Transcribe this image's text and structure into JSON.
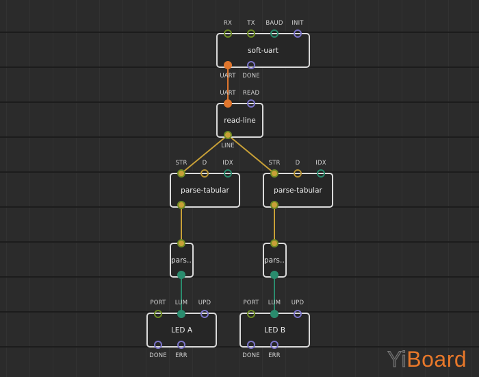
{
  "colors": {
    "background": "#2b2b2b",
    "node_border": "#dadada",
    "pin_gold": "#c8a037",
    "pin_orange": "#e0762d",
    "pin_green": "#2a8c6e",
    "pin_olive": "#6e8c24",
    "pin_violet": "#7b74c9",
    "link_gold": "#c8a037",
    "link_orange": "#e0762d",
    "link_green": "#2a8c6e"
  },
  "nodes": {
    "soft_uart": {
      "label": "soft-uart",
      "inputs": [
        "RX",
        "TX",
        "BAUD",
        "INIT"
      ],
      "outputs": [
        "UART",
        "DONE"
      ]
    },
    "read_line": {
      "label": "read-line",
      "inputs": [
        "UART",
        "READ"
      ],
      "outputs": [
        "LINE"
      ]
    },
    "parse_tabular_a": {
      "label": "parse-tabular",
      "inputs": [
        "STR",
        "D",
        "IDX"
      ]
    },
    "parse_tabular_b": {
      "label": "parse-tabular",
      "inputs": [
        "STR",
        "D",
        "IDX"
      ]
    },
    "parse_a": {
      "label": "pars…"
    },
    "parse_b": {
      "label": "pars…"
    },
    "led_a": {
      "label": "LED A",
      "inputs": [
        "PORT",
        "LUM",
        "UPD"
      ],
      "outputs": [
        "DONE",
        "ERR"
      ]
    },
    "led_b": {
      "label": "LED B",
      "inputs": [
        "PORT",
        "LUM",
        "UPD"
      ],
      "outputs": [
        "DONE",
        "ERR"
      ]
    }
  },
  "logo": {
    "part1": "Yi",
    "part2": "Board"
  }
}
